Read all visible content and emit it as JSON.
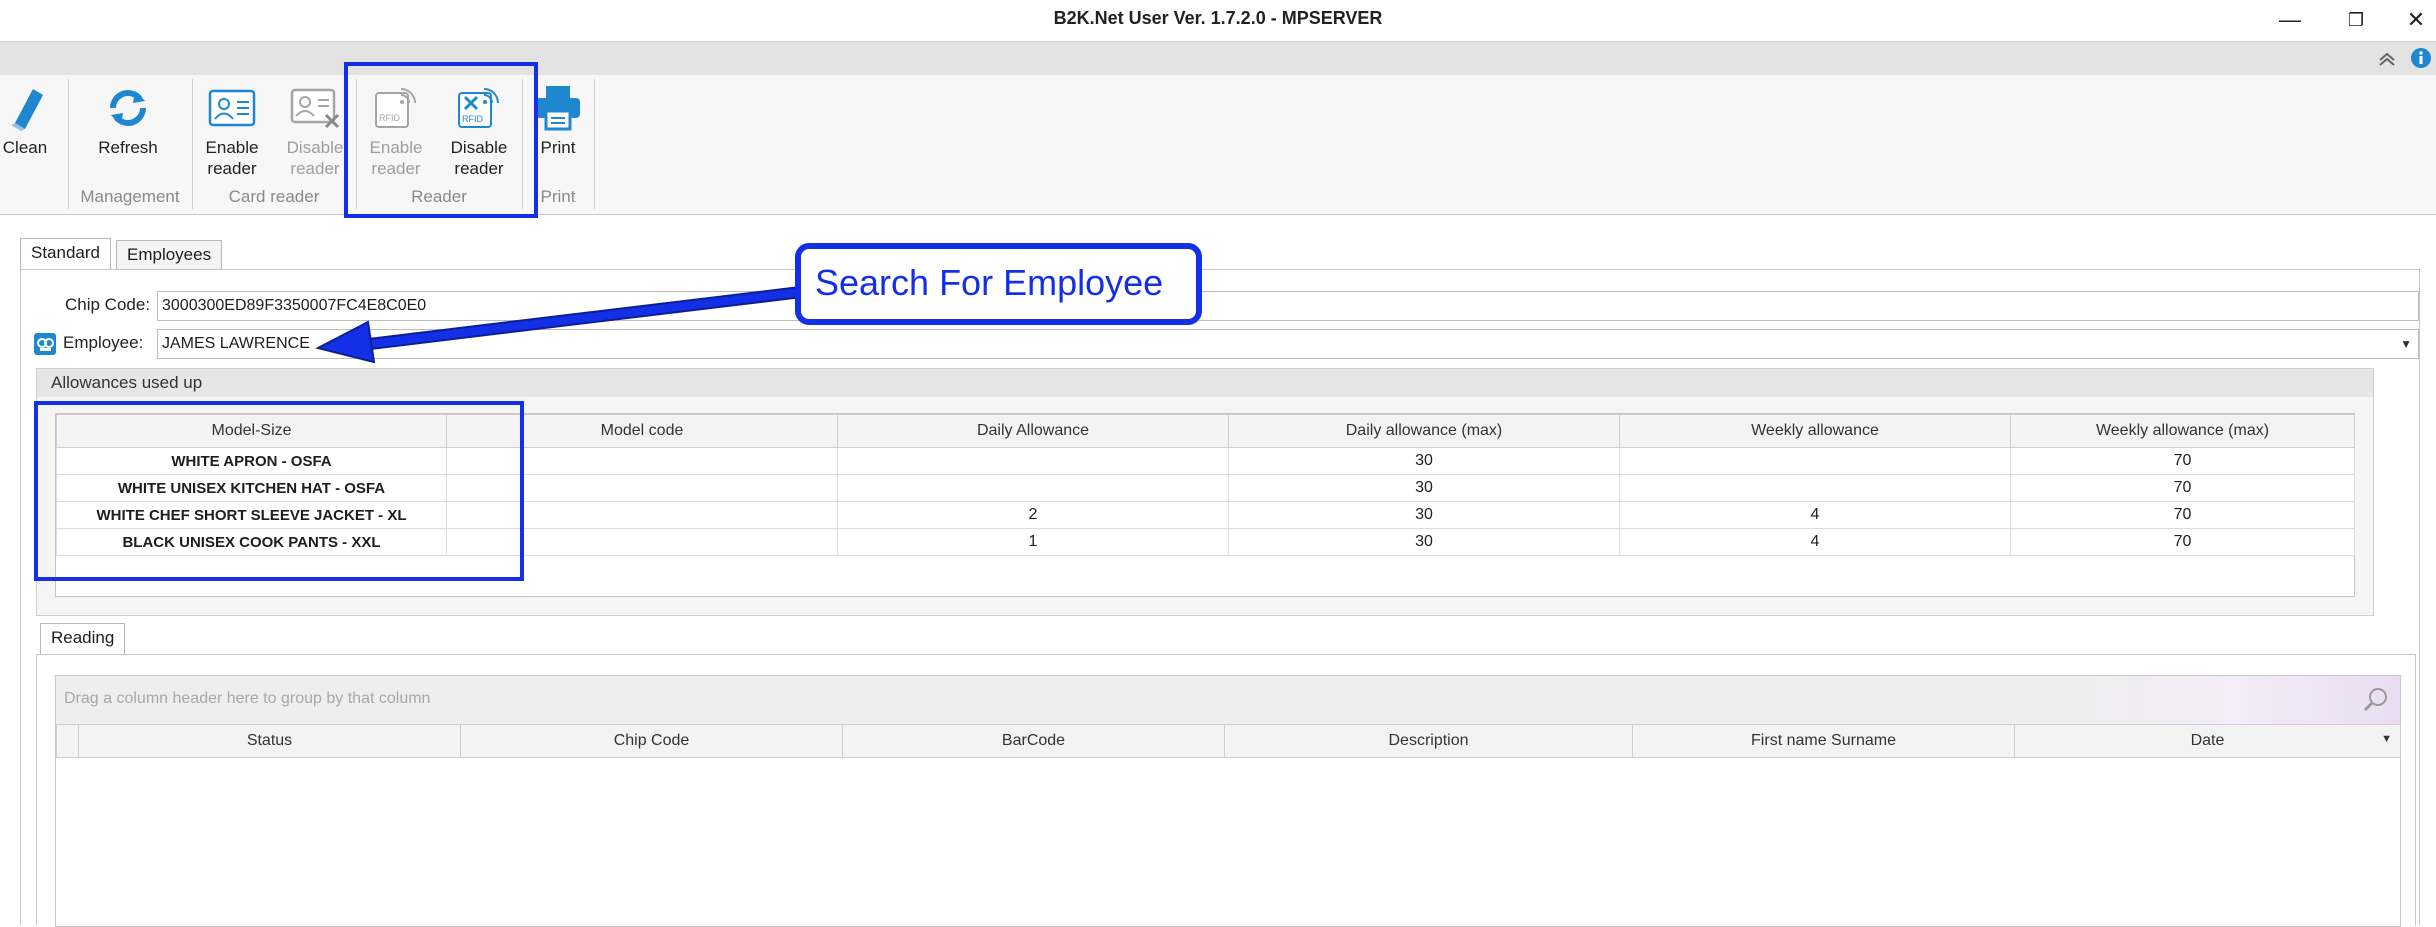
{
  "window": {
    "title": "B2K.Net User Ver. 1.7.2.0 - MPSERVER",
    "minimize": "—",
    "restore": "❐",
    "close": "✕"
  },
  "ribbon": {
    "buttons": {
      "clean": "Clean",
      "refresh": "Refresh",
      "enable_card": [
        "Enable",
        "reader"
      ],
      "disable_card": [
        "Disable",
        "reader"
      ],
      "enable_rfid": [
        "Enable",
        "reader"
      ],
      "disable_rfid": [
        "Disable",
        "reader"
      ],
      "print": "Print"
    },
    "groups": {
      "management": "Management",
      "card_reader": "Card reader",
      "reader": "Reader",
      "print": "Print"
    },
    "rfid_text": "RFID"
  },
  "tabs": {
    "standard": "Standard",
    "employees": "Employees"
  },
  "form": {
    "chip_code_label": "Chip Code:",
    "chip_code_value": "3000300ED89F3350007FC4E8C0E0",
    "employee_label": "Employee:",
    "employee_value": "JAMES LAWRENCE"
  },
  "allowances": {
    "title": "Allowances used up",
    "columns": [
      "Model-Size",
      "Model code",
      "Daily Allowance",
      "Daily allowance (max)",
      "Weekly allowance",
      "Weekly allowance (max)"
    ],
    "rows": [
      [
        "WHITE APRON - OSFA",
        "",
        "",
        "30",
        "",
        "70"
      ],
      [
        "WHITE UNISEX KITCHEN HAT - OSFA",
        "",
        "",
        "30",
        "",
        "70"
      ],
      [
        "WHITE CHEF SHORT SLEEVE JACKET - XL",
        "",
        "2",
        "30",
        "4",
        "70"
      ],
      [
        "BLACK UNISEX COOK PANTS - XXL",
        "",
        "1",
        "30",
        "4",
        "70"
      ]
    ]
  },
  "reading": {
    "tab": "Reading",
    "group_hint": "Drag a column header here to group by that column",
    "columns": [
      "Status",
      "Chip Code",
      "BarCode",
      "Description",
      "First name Surname",
      "Date"
    ]
  },
  "annotation": {
    "callout": "Search For Employee"
  },
  "colors": {
    "accent": "#1330e6",
    "icon_blue": "#1f86d0"
  }
}
